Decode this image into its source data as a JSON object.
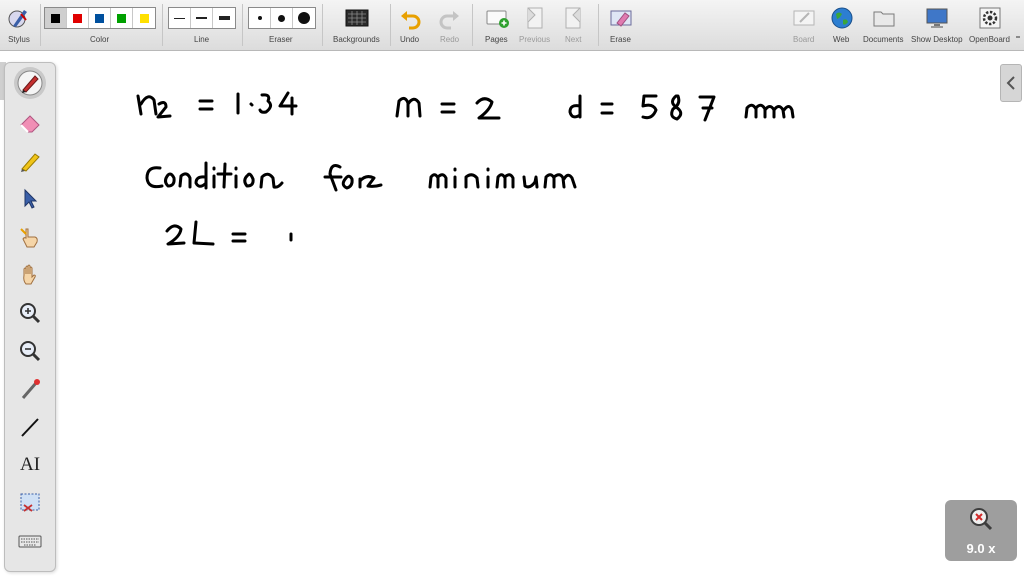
{
  "toolbar": {
    "stylus": "Stylus",
    "color": "Color",
    "line": "Line",
    "eraser": "Eraser",
    "backgrounds": "Backgrounds",
    "undo": "Undo",
    "redo": "Redo",
    "pages": "Pages",
    "previous": "Previous",
    "next": "Next",
    "erase": "Erase",
    "board": "Board",
    "web": "Web",
    "documents": "Documents",
    "show_desktop": "Show Desktop",
    "openboard": "OpenBoard"
  },
  "colors": {
    "swatches": [
      "#000000",
      "#e00000",
      "#00509e",
      "#00a000",
      "#ffe000"
    ],
    "selected_index": 0
  },
  "palette": {
    "tools": [
      "pen-icon",
      "eraser-icon",
      "marker-icon",
      "selector-icon",
      "play-hand-icon",
      "hand-icon",
      "zoom-in-icon",
      "zoom-out-icon",
      "laser-pointer-icon",
      "line-icon",
      "text-icon",
      "capture-icon",
      "keyboard-icon"
    ],
    "selected": "pen-icon",
    "text_tool_label": "AI"
  },
  "zoom": {
    "label": "9.0 x"
  }
}
